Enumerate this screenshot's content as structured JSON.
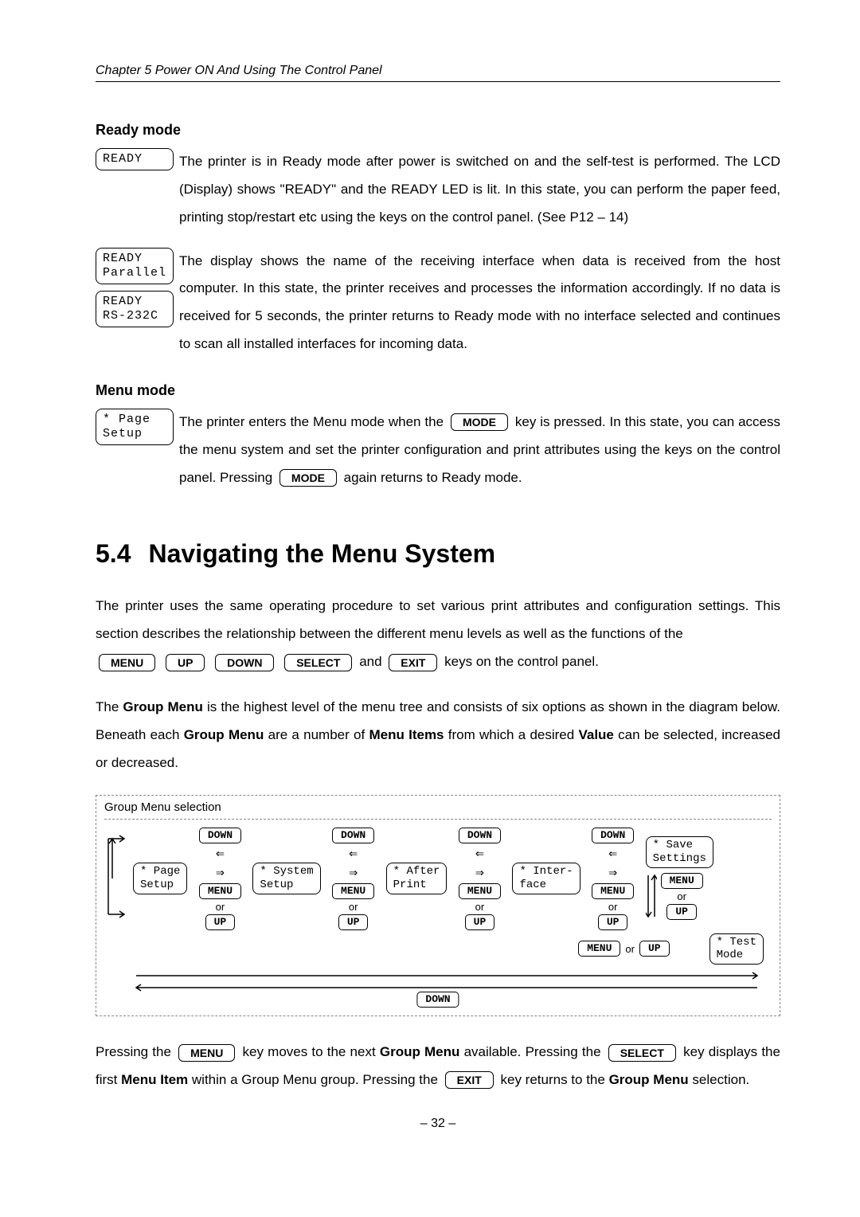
{
  "chapter_header": "Chapter 5    Power ON And Using The Control Panel",
  "ready_mode": {
    "heading": "Ready mode",
    "lcd1": "READY",
    "para1": "The printer is in Ready mode after power is switched on and the self-test is performed. The LCD (Display) shows \"READY\" and the READY LED is lit. In this state, you can perform the paper feed, printing stop/restart etc using the keys on the control panel. (See P12 – 14)",
    "lcd2_line1": "READY",
    "lcd2_line2": "Parallel",
    "lcd3_line1": "READY",
    "lcd3_line2": "RS-232C",
    "para2": "The display shows the name of the receiving interface when data is received from the host computer. In this state, the printer receives and processes the information accordingly.",
    "para3": "If no data is received for 5 seconds, the printer returns to Ready mode with no interface selected and continues to scan all installed interfaces for incoming data."
  },
  "menu_mode": {
    "heading": "Menu mode",
    "lcd_line1": "* Page",
    "lcd_line2": "  Setup",
    "para_part1": "The printer enters the Menu mode when the ",
    "key1": "MODE",
    "para_part2": " key is pressed. In this state, you can access the menu system and set the printer configuration and print attributes using the keys on the control panel. Pressing ",
    "key2": "MODE",
    "para_part3": " again returns to Ready mode."
  },
  "nav_section": {
    "number": "5.4",
    "title": "Navigating the Menu System",
    "para1_part1": "The printer uses the same operating procedure to set various print attributes and configuration settings. This section describes the relationship between the different menu levels as well as the functions of the ",
    "k1": "MENU",
    "k2": "UP",
    "k3": "DOWN",
    "k4": "SELECT",
    "and": " and ",
    "k5": "EXIT",
    "para1_part2": " keys on the control panel.",
    "para2_part1": "The ",
    "b1": "Group Menu",
    "para2_part2": " is the highest level of the menu tree and consists of six options as shown in the diagram below. Beneath each ",
    "b2": "Group Menu",
    "para2_part3": " are a number of ",
    "b3": "Menu Items",
    "para2_part4": " from which a desired ",
    "b4": "Value",
    "para2_part5": " can be selected, increased or decreased.",
    "para3_part1": "Pressing the ",
    "pk1": "MENU",
    "para3_part2": " key moves to the next ",
    "pb1": "Group Menu",
    "para3_part3": " available. Pressing the ",
    "pk2": "SELECT",
    "para3_part4": " key displays the first ",
    "pb2": "Menu Item",
    "para3_part5": " within a Group Menu group. Pressing the ",
    "pk3": "EXIT",
    "para3_part6": " key returns to the ",
    "pb3": "Group Menu",
    "para3_part7": " selection."
  },
  "diagram": {
    "title": "Group Menu selection",
    "down": "DOWN",
    "menu": "MENU",
    "up": "UP",
    "or": "or",
    "nodes": {
      "n1l1": "* Page",
      "n1l2": "  Setup",
      "n2l1": "* System",
      "n2l2": "  Setup",
      "n3l1": "* After",
      "n3l2": "  Print",
      "n4l1": "* Inter-",
      "n4l2": "  face",
      "n5l1": "* Save",
      "n5l2": "Settings",
      "n6l1": "* Test",
      "n6l2": "   Mode"
    }
  },
  "page_number": "– 32 –"
}
